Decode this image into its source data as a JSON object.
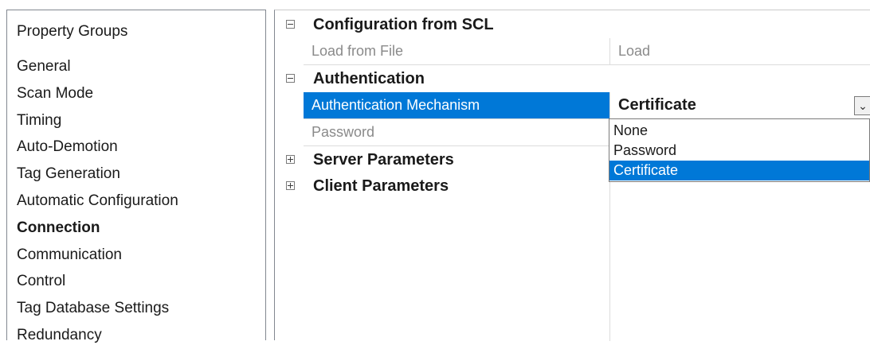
{
  "groups": {
    "header": "Property Groups",
    "items": [
      {
        "label": "General"
      },
      {
        "label": "Scan Mode"
      },
      {
        "label": "Timing"
      },
      {
        "label": "Auto-Demotion"
      },
      {
        "label": "Tag Generation"
      },
      {
        "label": "Automatic Configuration"
      },
      {
        "label": "Connection",
        "active": true
      },
      {
        "label": "Communication"
      },
      {
        "label": "Control"
      },
      {
        "label": "Tag Database Settings"
      },
      {
        "label": "Redundancy"
      }
    ]
  },
  "grid": {
    "cat_scl": "Configuration from SCL",
    "load_from_file": {
      "name": "Load from File",
      "value": "Load"
    },
    "cat_auth": "Authentication",
    "auth_mechanism": {
      "name": "Authentication Mechanism",
      "value": "Certificate"
    },
    "password": {
      "name": "Password"
    },
    "cat_server": "Server Parameters",
    "cat_client": "Client Parameters"
  },
  "dropdown": {
    "options": [
      "None",
      "Password",
      "Certificate"
    ],
    "selected": "Certificate"
  },
  "colors": {
    "selection": "#0078d7",
    "disabled_text": "#8a8a8a"
  }
}
